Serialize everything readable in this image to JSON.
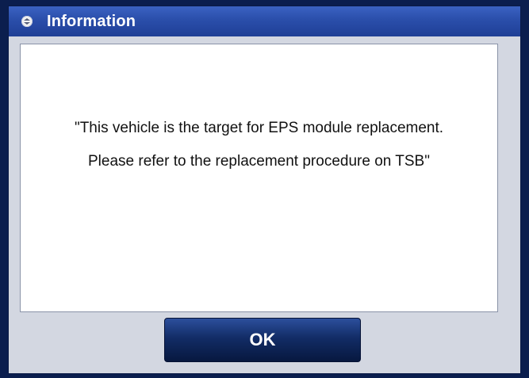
{
  "dialog": {
    "title": "Information",
    "icon": "scroll-arrows-icon",
    "message_line1": "\"This vehicle is the target for EPS module replacement.",
    "message_line2": "Please refer to the replacement procedure on TSB\"",
    "ok_label": "OK"
  },
  "colors": {
    "titlebar": "#2a4eaa",
    "background": "#d3d7e1",
    "panel": "#ffffff",
    "button": "#122c66"
  }
}
